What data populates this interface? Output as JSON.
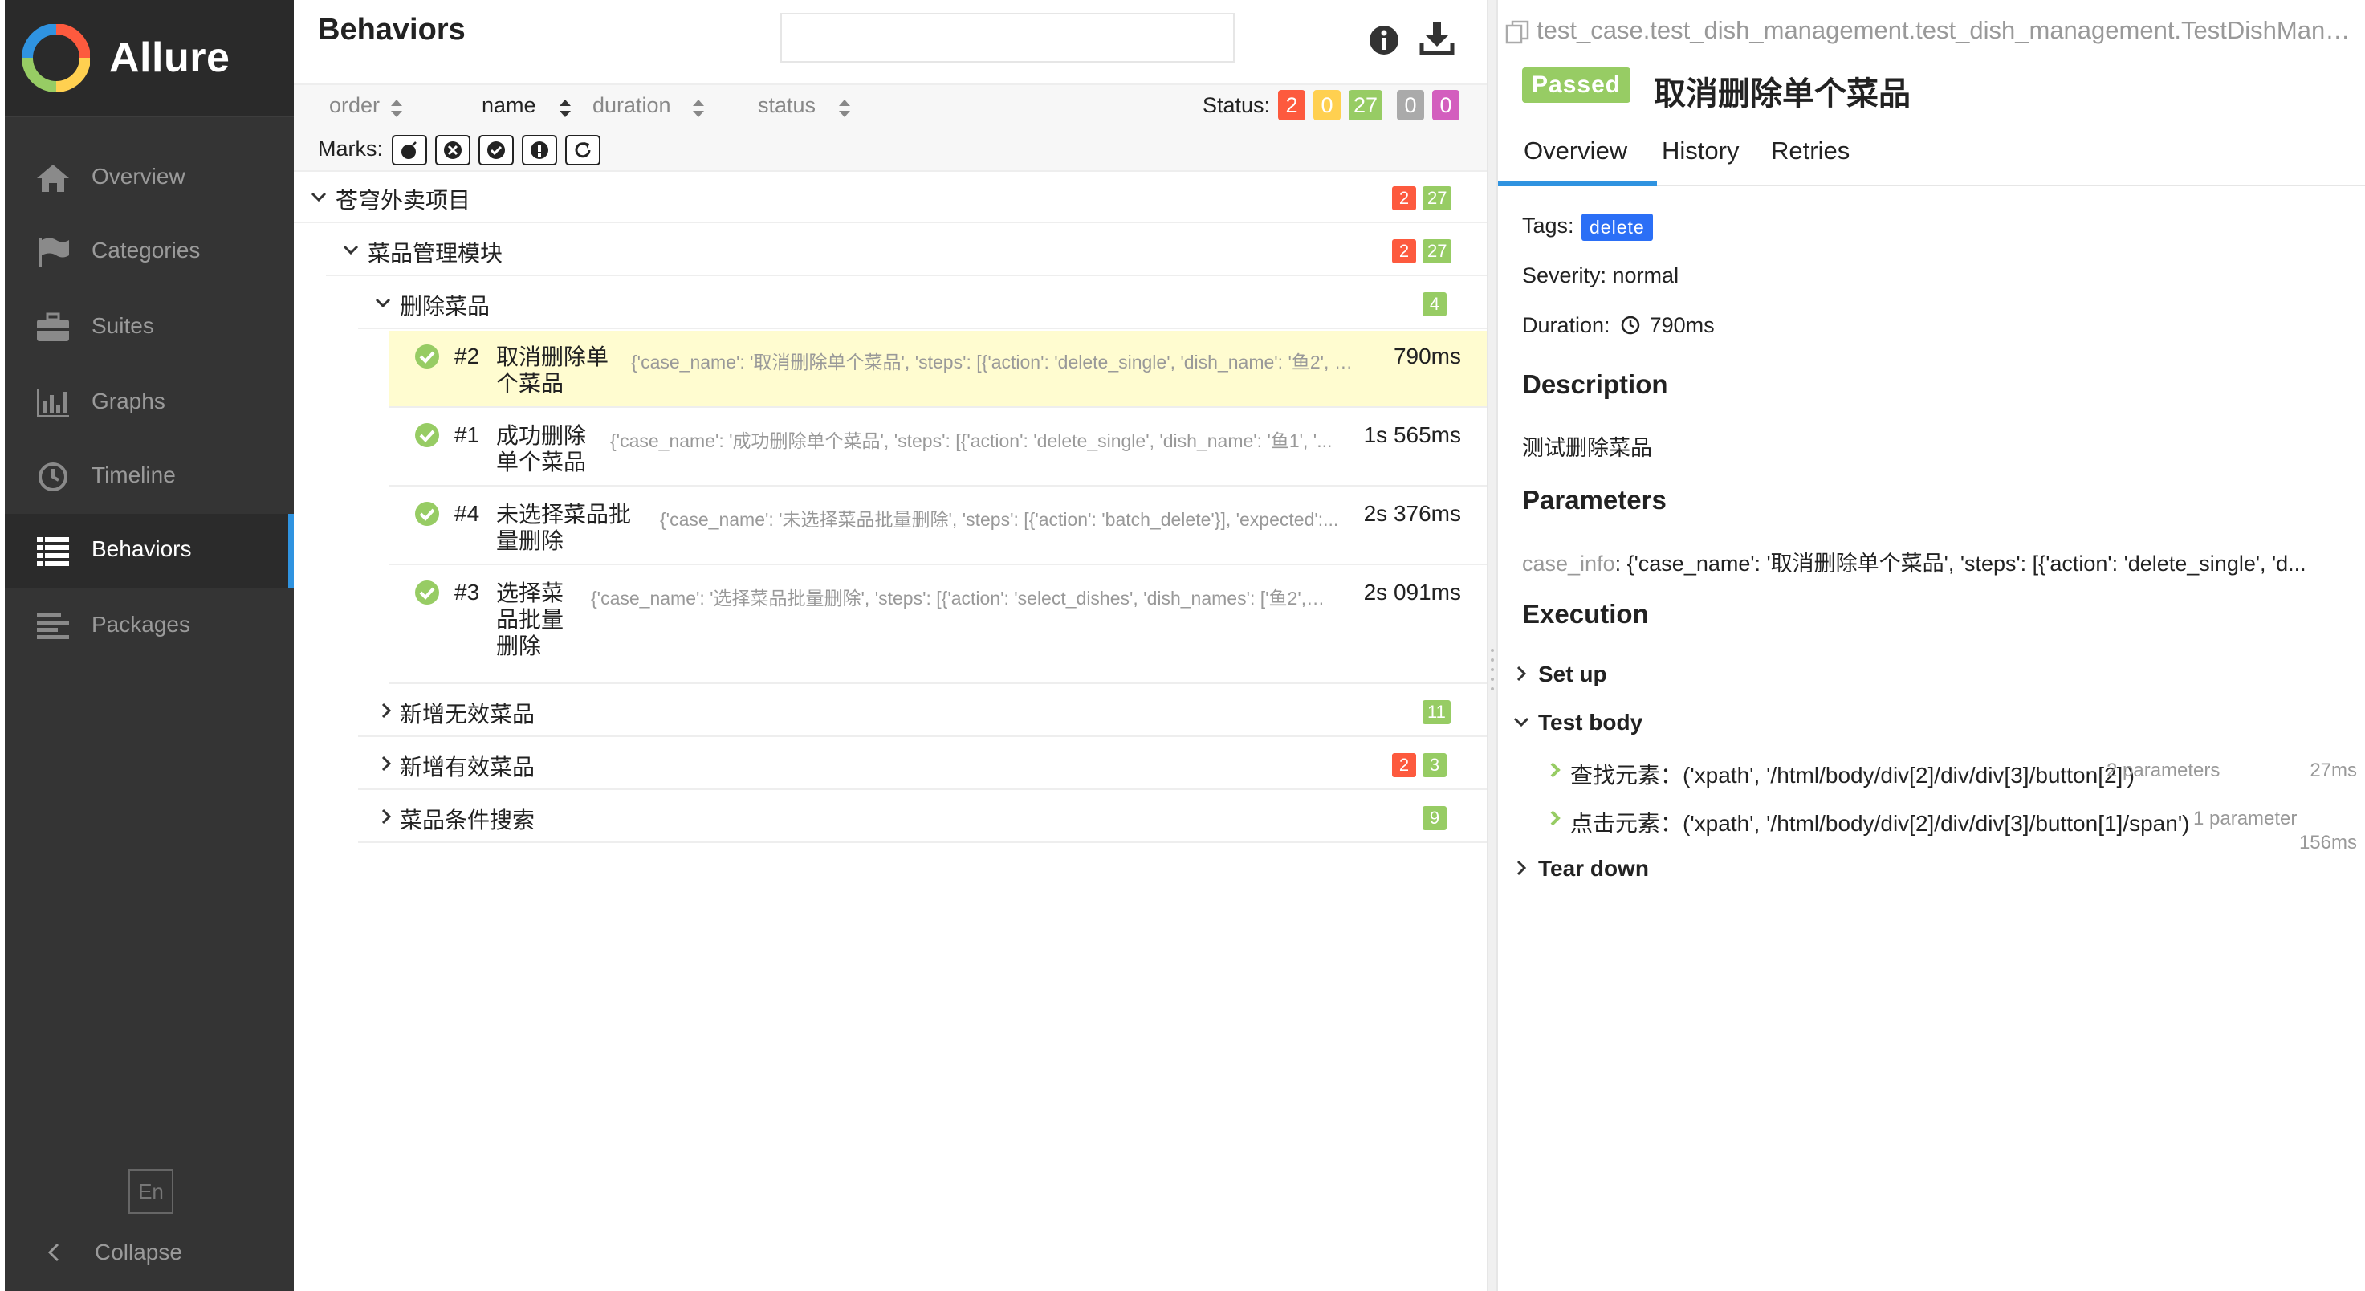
{
  "sidebar": {
    "brand": "Allure",
    "nav": [
      {
        "label": "Overview",
        "icon": "home-icon"
      },
      {
        "label": "Categories",
        "icon": "flag-icon"
      },
      {
        "label": "Suites",
        "icon": "briefcase-icon"
      },
      {
        "label": "Graphs",
        "icon": "bar-chart-icon"
      },
      {
        "label": "Timeline",
        "icon": "clock-icon"
      },
      {
        "label": "Behaviors",
        "icon": "list-icon"
      },
      {
        "label": "Packages",
        "icon": "align-left-icon"
      }
    ],
    "active_nav": "Behaviors",
    "language": "En",
    "collapse": "Collapse"
  },
  "behaviors": {
    "title": "Behaviors",
    "search_placeholder": "",
    "sort": {
      "order": "order",
      "name": "name",
      "duration": "duration",
      "status": "status"
    },
    "status_label": "Status:",
    "status_counts": {
      "failed": "2",
      "broken": "0",
      "passed": "27",
      "skipped": "0",
      "unknown": "0"
    },
    "marks_label": "Marks:",
    "tree": {
      "epic": {
        "label": "苍穹外卖项目",
        "failed": "2",
        "passed": "27"
      },
      "feature": {
        "label": "菜品管理模块",
        "failed": "2",
        "passed": "27"
      },
      "story": {
        "label": "删除菜品",
        "passed": "4"
      },
      "tests": [
        {
          "num": "#2",
          "name": "取消删除单个菜品",
          "params": "{'case_name': '取消删除单个菜品', 'steps': [{'action': 'delete_single', 'dish_name': '鱼2', 'c...",
          "duration": "790ms"
        },
        {
          "num": "#1",
          "name": "成功删除单个菜品",
          "params": "{'case_name': '成功删除单个菜品', 'steps': [{'action': 'delete_single', 'dish_name': '鱼1', '...",
          "duration": "1s 565ms"
        },
        {
          "num": "#4",
          "name": "未选择菜品批量删除",
          "params": "{'case_name': '未选择菜品批量删除', 'steps': [{'action': 'batch_delete'}], 'expected':...",
          "duration": "2s 376ms"
        },
        {
          "num": "#3",
          "name": "选择菜品批量删除",
          "params": "{'case_name': '选择菜品批量删除', 'steps': [{'action': 'select_dishes', 'dish_names': ['鱼2', '...",
          "duration": "2s 091ms"
        }
      ],
      "other_stories": [
        {
          "label": "新增无效菜品",
          "passed": "11"
        },
        {
          "label": "新增有效菜品",
          "failed": "2",
          "passed": "3"
        },
        {
          "label": "菜品条件搜索",
          "passed": "9"
        }
      ]
    }
  },
  "testcase": {
    "full_name": "test_case.test_dish_management.test_dish_management.TestDishManagement#test_delete_dish",
    "status": "Passed",
    "title": "取消删除单个菜品",
    "tabs": [
      "Overview",
      "History",
      "Retries"
    ],
    "tags_label": "Tags:",
    "tag": "delete",
    "severity": "Severity: normal",
    "duration_label": "Duration:",
    "duration": "790ms",
    "description_head": "Description",
    "description": "测试删除菜品",
    "parameters_head": "Parameters",
    "param_name": "case_info",
    "param_value": "{'case_name': '取消删除单个菜品', 'steps': [{'action': 'delete_single', 'd...",
    "execution_head": "Execution",
    "setup": "Set up",
    "body": "Test body",
    "steps": [
      {
        "text": "查找元素：('xpath', '/html/body/div[2]/div/div[3]/button[2]')",
        "params": "2 parameters",
        "duration": "27ms"
      },
      {
        "text": "点击元素：('xpath', '/html/body/div[2]/div/div[3]/button[1]/span')",
        "params": "1 parameter",
        "duration": "156ms"
      }
    ],
    "teardown": "Tear down"
  },
  "colors": {
    "failed": "#fd5a3e",
    "broken": "#ffd050",
    "passed": "#97cc64",
    "skipped": "#aaaaaa",
    "unknown": "#d35ebe",
    "accent": "#2f93e0"
  }
}
